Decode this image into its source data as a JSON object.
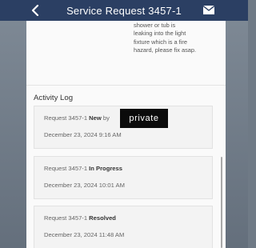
{
  "navbar": {
    "title": "Service Request 3457-1",
    "back_icon": "chevron-left-icon",
    "mail_icon": "envelope-icon",
    "bg_color": "#2b3f63"
  },
  "description": {
    "lines": [
      "shower or tub is",
      "leaking into the light",
      "fixture which is a fire",
      "hazard, please fix asap."
    ]
  },
  "activity_log": {
    "title": "Activity Log",
    "items": [
      {
        "prefix": "Request 3457-1",
        "status": "New",
        "suffix": "by",
        "date": "December 23, 2024 9:16 AM"
      },
      {
        "prefix": "Request 3457-1",
        "status": "In Progress",
        "suffix": "",
        "date": "December 23, 2024 10:01 AM"
      },
      {
        "prefix": "Request 3457-1",
        "status": "Resolved",
        "suffix": "",
        "date": "December 23, 2024 11:48 AM"
      }
    ]
  },
  "redaction": {
    "label": "private"
  }
}
